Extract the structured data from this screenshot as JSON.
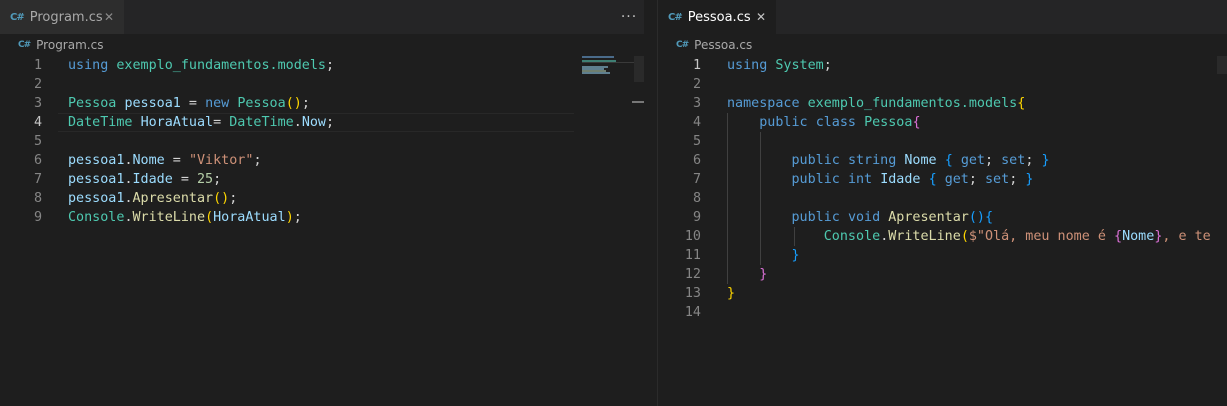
{
  "left_pane": {
    "tab": {
      "icon": "csharp-file-icon",
      "label": "Program.cs",
      "close": "✕"
    },
    "more_actions": "···",
    "breadcrumb": {
      "icon": "csharp-file-icon",
      "label": "Program.cs"
    },
    "current_line": 4,
    "lines": [
      {
        "n": "1",
        "tokens": [
          [
            "kw",
            "using"
          ],
          [
            "pl",
            " "
          ],
          [
            "ty",
            "exemplo_fundamentos.models"
          ],
          [
            "pl",
            ";"
          ]
        ]
      },
      {
        "n": "2",
        "tokens": []
      },
      {
        "n": "3",
        "tokens": [
          [
            "ty",
            "Pessoa"
          ],
          [
            "pl",
            " "
          ],
          [
            "va",
            "pessoa1"
          ],
          [
            "pl",
            " = "
          ],
          [
            "kw",
            "new"
          ],
          [
            "pl",
            " "
          ],
          [
            "ty",
            "Pessoa"
          ],
          [
            "b1",
            "()"
          ],
          [
            "pl",
            ";"
          ]
        ]
      },
      {
        "n": "4",
        "tokens": [
          [
            "ty",
            "DateTime"
          ],
          [
            "pl",
            " "
          ],
          [
            "va",
            "HoraAtual"
          ],
          [
            "pl",
            "= "
          ],
          [
            "ty",
            "DateTime"
          ],
          [
            "pl",
            "."
          ],
          [
            "va",
            "Now"
          ],
          [
            "pl",
            ";"
          ]
        ]
      },
      {
        "n": "5",
        "tokens": []
      },
      {
        "n": "6",
        "tokens": [
          [
            "va",
            "pessoa1"
          ],
          [
            "pl",
            "."
          ],
          [
            "va",
            "Nome"
          ],
          [
            "pl",
            " = "
          ],
          [
            "st",
            "\"Viktor\""
          ],
          [
            "pl",
            ";"
          ]
        ]
      },
      {
        "n": "7",
        "tokens": [
          [
            "va",
            "pessoa1"
          ],
          [
            "pl",
            "."
          ],
          [
            "va",
            "Idade"
          ],
          [
            "pl",
            " = "
          ],
          [
            "nu",
            "25"
          ],
          [
            "pl",
            ";"
          ]
        ]
      },
      {
        "n": "8",
        "tokens": [
          [
            "va",
            "pessoa1"
          ],
          [
            "pl",
            "."
          ],
          [
            "fn",
            "Apresentar"
          ],
          [
            "b1",
            "()"
          ],
          [
            "pl",
            ";"
          ]
        ]
      },
      {
        "n": "9",
        "tokens": [
          [
            "ty",
            "Console"
          ],
          [
            "pl",
            "."
          ],
          [
            "fn",
            "WriteLine"
          ],
          [
            "b1",
            "("
          ],
          [
            "va",
            "HoraAtual"
          ],
          [
            "b1",
            ")"
          ],
          [
            "pl",
            ";"
          ]
        ]
      }
    ]
  },
  "right_pane": {
    "tab": {
      "icon": "csharp-file-icon",
      "label": "Pessoa.cs",
      "close": "✕"
    },
    "breadcrumb": {
      "icon": "csharp-file-icon",
      "label": "Pessoa.cs"
    },
    "current_line": 1,
    "lines": [
      {
        "n": "1",
        "tokens": [
          [
            "kw",
            "using"
          ],
          [
            "pl",
            " "
          ],
          [
            "ty",
            "System"
          ],
          [
            "pl",
            ";"
          ]
        ]
      },
      {
        "n": "2",
        "tokens": []
      },
      {
        "n": "3",
        "tokens": [
          [
            "kw",
            "namespace"
          ],
          [
            "pl",
            " "
          ],
          [
            "ty",
            "exemplo_fundamentos.models"
          ],
          [
            "b1",
            "{"
          ]
        ]
      },
      {
        "n": "4",
        "tokens": [
          [
            "pl",
            "    "
          ],
          [
            "kw",
            "public"
          ],
          [
            "pl",
            " "
          ],
          [
            "kw",
            "class"
          ],
          [
            "pl",
            " "
          ],
          [
            "ty",
            "Pessoa"
          ],
          [
            "b2",
            "{"
          ]
        ]
      },
      {
        "n": "5",
        "tokens": []
      },
      {
        "n": "6",
        "tokens": [
          [
            "pl",
            "        "
          ],
          [
            "kw",
            "public"
          ],
          [
            "pl",
            " "
          ],
          [
            "kw",
            "string"
          ],
          [
            "pl",
            " "
          ],
          [
            "va",
            "Nome"
          ],
          [
            "pl",
            " "
          ],
          [
            "b3",
            "{"
          ],
          [
            "pl",
            " "
          ],
          [
            "kw",
            "get"
          ],
          [
            "pl",
            "; "
          ],
          [
            "kw",
            "set"
          ],
          [
            "pl",
            "; "
          ],
          [
            "b3",
            "}"
          ]
        ]
      },
      {
        "n": "7",
        "tokens": [
          [
            "pl",
            "        "
          ],
          [
            "kw",
            "public"
          ],
          [
            "pl",
            " "
          ],
          [
            "kw",
            "int"
          ],
          [
            "pl",
            " "
          ],
          [
            "va",
            "Idade"
          ],
          [
            "pl",
            " "
          ],
          [
            "b3",
            "{"
          ],
          [
            "pl",
            " "
          ],
          [
            "kw",
            "get"
          ],
          [
            "pl",
            "; "
          ],
          [
            "kw",
            "set"
          ],
          [
            "pl",
            "; "
          ],
          [
            "b3",
            "}"
          ]
        ]
      },
      {
        "n": "8",
        "tokens": []
      },
      {
        "n": "9",
        "tokens": [
          [
            "pl",
            "        "
          ],
          [
            "kw",
            "public"
          ],
          [
            "pl",
            " "
          ],
          [
            "kw",
            "void"
          ],
          [
            "pl",
            " "
          ],
          [
            "fn",
            "Apresentar"
          ],
          [
            "b3",
            "()"
          ],
          [
            "b3",
            "{"
          ]
        ]
      },
      {
        "n": "10",
        "tokens": [
          [
            "pl",
            "            "
          ],
          [
            "ty",
            "Console"
          ],
          [
            "pl",
            "."
          ],
          [
            "fn",
            "WriteLine"
          ],
          [
            "b1",
            "("
          ],
          [
            "st",
            "$\"Olá, meu nome é "
          ],
          [
            "b2",
            "{"
          ],
          [
            "va",
            "Nome"
          ],
          [
            "b2",
            "}"
          ],
          [
            "st",
            ", e te"
          ]
        ]
      },
      {
        "n": "11",
        "tokens": [
          [
            "pl",
            "        "
          ],
          [
            "b3",
            "}"
          ]
        ]
      },
      {
        "n": "12",
        "tokens": [
          [
            "pl",
            "    "
          ],
          [
            "b2",
            "}"
          ]
        ]
      },
      {
        "n": "13",
        "tokens": [
          [
            "b1",
            "}"
          ]
        ]
      },
      {
        "n": "14",
        "tokens": []
      }
    ]
  }
}
